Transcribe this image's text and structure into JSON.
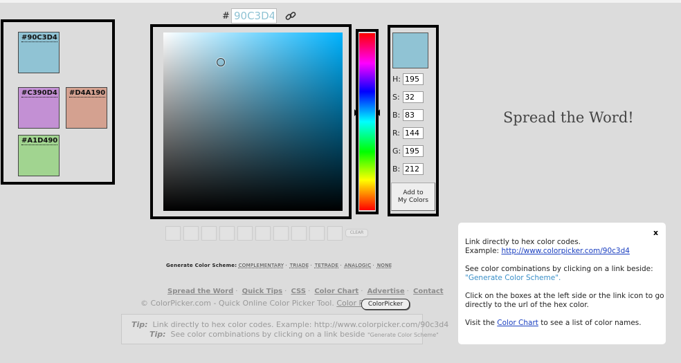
{
  "hex": {
    "hash": "#",
    "value": "90C3D4"
  },
  "swatches": [
    {
      "label": "#90C3D4",
      "color": "#90c3d4"
    },
    {
      "label": "#C390D4",
      "color": "#c390d4"
    },
    {
      "label": "#D4A190",
      "color": "#d4a190"
    },
    {
      "label": "#A1D490",
      "color": "#a1d490"
    }
  ],
  "values": {
    "h_label": "H:",
    "h": "195",
    "s_label": "S:",
    "s": "32",
    "b_label": "B:",
    "b": "83",
    "r_label": "R:",
    "r": "144",
    "g_label": "G:",
    "g": "195",
    "bl_label": "B:",
    "bl": "212"
  },
  "add_button": {
    "line1": "Add to",
    "line2": "My Colors"
  },
  "clear_label": "CLEAR",
  "scheme": {
    "label": "Generate Color Scheme:",
    "options": [
      "COMPLEMENTARY",
      "TRIADE",
      "TETRADE",
      "ANALOGIC",
      "NONE"
    ]
  },
  "footer": {
    "links": [
      "Spread the Word",
      "Quick Tips",
      "CSS",
      "Color Chart",
      "Advertise",
      "Contact"
    ],
    "line2_text": "© ColorPicker.com - Quick Online Color Picker Tool.",
    "line2_link": "Color Picker",
    "badge": "ColorPicker"
  },
  "tips": {
    "tip_label": "Tip:",
    "tip1": "Link directly to hex color codes.   Example: http://www.colorpicker.com/90c3d4",
    "tip2": "See color combinations by clicking on a link beside",
    "tip2_small": "\"Generate Color Scheme\""
  },
  "spread_title": "Spread the Word!",
  "info": {
    "close": "x",
    "p1_line1": "Link directly to hex color codes.",
    "p1_line2_prefix": "Example: ",
    "p1_line2_link": "http://www.colorpicker.com/90c3d4",
    "p2_line1": "See color combinations by clicking on a link beside:",
    "p2_line2": "\"Generate Color Scheme\".",
    "p3_line1": "Click on the boxes at the left side or the link icon to go",
    "p3_line2": "directly to the url of the hex color.",
    "p4_prefix": "Visit the ",
    "p4_link": "Color Chart",
    "p4_suffix": " to see a list of color names."
  }
}
